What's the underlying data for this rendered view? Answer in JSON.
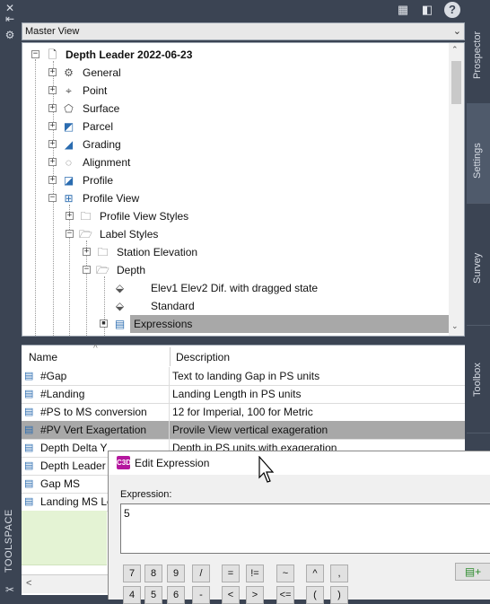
{
  "left_strip": {
    "icons": [
      "close-icon",
      "pin-icon",
      "gear-icon"
    ],
    "label": "TOOLSPACE"
  },
  "toolbar": {
    "icons": [
      "tree-view-icon",
      "panel-layout-icon",
      "help-icon"
    ],
    "help_label": "?"
  },
  "master_view": {
    "label": "Master View"
  },
  "tree": {
    "items": [
      {
        "label": "Depth Leader 2022-06-23",
        "icon": "drawing-icon",
        "bold": true
      },
      {
        "label": "General",
        "icon": "general-settings-icon"
      },
      {
        "label": "Point",
        "icon": "point-icon"
      },
      {
        "label": "Surface",
        "icon": "surface-icon"
      },
      {
        "label": "Parcel",
        "icon": "parcel-icon"
      },
      {
        "label": "Grading",
        "icon": "grading-icon"
      },
      {
        "label": "Alignment",
        "icon": "alignment-icon"
      },
      {
        "label": "Profile",
        "icon": "profile-icon"
      },
      {
        "label": "Profile View",
        "icon": "profile-view-icon"
      },
      {
        "label": "Profile View Styles",
        "icon": "folder-icon"
      },
      {
        "label": "Label Styles",
        "icon": "folder-icon"
      },
      {
        "label": "Station Elevation",
        "icon": "folder-icon"
      },
      {
        "label": "Depth",
        "icon": "folder-icon"
      },
      {
        "label": "Elev1 Elev2  Dif. with dragged state",
        "icon": "label-style-icon"
      },
      {
        "label": "Standard",
        "icon": "label-style-icon"
      },
      {
        "label": "Expressions",
        "icon": "expression-icon"
      }
    ]
  },
  "right_tabs": [
    {
      "label": "Prospector"
    },
    {
      "label": "Settings"
    },
    {
      "label": "Survey"
    },
    {
      "label": "Toolbox"
    }
  ],
  "list": {
    "columns": [
      "Name",
      "Description"
    ],
    "rows": [
      {
        "name": "#Gap",
        "description": "Text to landing Gap in PS units"
      },
      {
        "name": "#Landing",
        "description": "Landing Length in PS units"
      },
      {
        "name": "#PS to MS conversion",
        "description": "12 for Imperial, 100 for Metric"
      },
      {
        "name": "#PV Vert Exagertation",
        "description": "Provile View vertical exageration"
      },
      {
        "name": "Depth Delta Y",
        "description": "Depth in PS units with exageration"
      },
      {
        "name": "Depth Leader L",
        "description": ""
      },
      {
        "name": "Gap MS",
        "description": ""
      },
      {
        "name": "Landing MS Le",
        "description": ""
      }
    ]
  },
  "dialog": {
    "title": "Edit Expression",
    "icon_text": "C3D",
    "expression_label": "Expression:",
    "expression_value": "5",
    "keypad_row1": [
      "7",
      "8",
      "9",
      "/",
      "=",
      "!=",
      "~",
      "^",
      ","
    ],
    "keypad_row2": [
      "4",
      "5",
      "6",
      "-",
      "<",
      ">",
      "<=",
      "(",
      ")"
    ],
    "insert_icon": "insert-property-icon"
  }
}
